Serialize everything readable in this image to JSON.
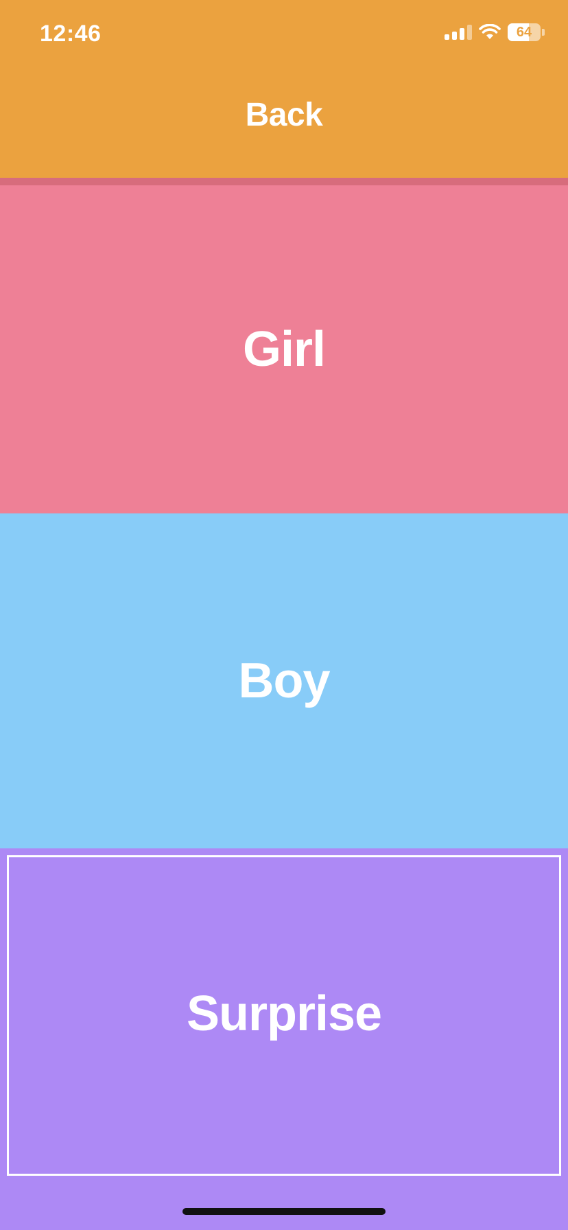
{
  "status_bar": {
    "time": "12:46",
    "battery_percent": "64",
    "battery_level": 0.64,
    "signal_bars_active": 3,
    "signal_bars_total": 4,
    "wifi_icon": "wifi-icon"
  },
  "header": {
    "back_label": "Back"
  },
  "options": {
    "girl": "Girl",
    "boy": "Boy",
    "surprise": "Surprise"
  },
  "colors": {
    "header_bg": "#EBA23F",
    "girl_bg": "#EE8096",
    "boy_bg": "#88CCF8",
    "surprise_bg": "#AD89F5"
  }
}
